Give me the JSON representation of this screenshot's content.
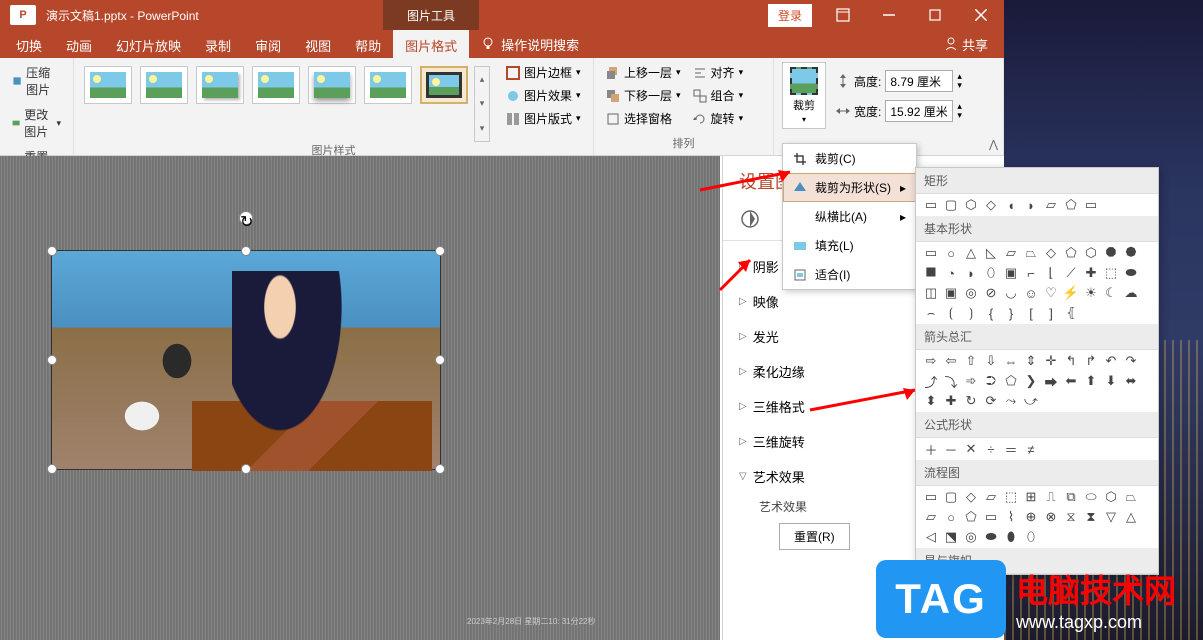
{
  "title": "演示文稿1.pptx - PowerPoint",
  "contextual_tab": "图片工具",
  "login": "登录",
  "share": "共享",
  "tabs": {
    "切换": "切换",
    "动画": "动画",
    "幻灯片放映": "幻灯片放映",
    "录制": "录制",
    "审阅": "审阅",
    "视图": "视图",
    "帮助": "帮助",
    "图片格式": "图片格式"
  },
  "tell_me": "操作说明搜索",
  "ribbon": {
    "adjust": {
      "compress": "压缩图片",
      "change": "更改图片",
      "reset": "重置图片"
    },
    "styles_label": "图片样式",
    "pic_border": "图片边框",
    "pic_effects": "图片效果",
    "pic_layout": "图片版式",
    "arrange_label": "排列",
    "bring_forward": "上移一层",
    "send_backward": "下移一层",
    "selection_pane": "选择窗格",
    "align": "对齐",
    "group": "组合",
    "rotate": "旋转",
    "crop": "裁剪",
    "height_label": "高度:",
    "height_value": "8.79 厘米",
    "width_label": "宽度:",
    "width_value": "15.92 厘米"
  },
  "crop_menu": {
    "crop": "裁剪(C)",
    "crop_to_shape": "裁剪为形状(S)",
    "aspect_ratio": "纵横比(A)",
    "fill": "填充(L)",
    "fit": "适合(I)"
  },
  "shape_categories": {
    "rect": "矩形",
    "basic": "基本形状",
    "arrows": "箭头总汇",
    "equation": "公式形状",
    "flowchart": "流程图",
    "stars": "星与旗帜"
  },
  "panel": {
    "title": "设置图",
    "shadow": "阴影",
    "reflection": "映像",
    "glow": "发光",
    "soft_edges": "柔化边缘",
    "3d_format": "三维格式",
    "3d_rotation": "三维旋转",
    "artistic": "艺术效果",
    "artistic_sub": "艺术效果",
    "reset": "重置(R)"
  },
  "timestamp": "2023年2月28日 星期二10:\n31分22秒",
  "watermark": {
    "tag": "TAG",
    "cn": "电脑技术网",
    "url": "www.tagxp.com"
  }
}
